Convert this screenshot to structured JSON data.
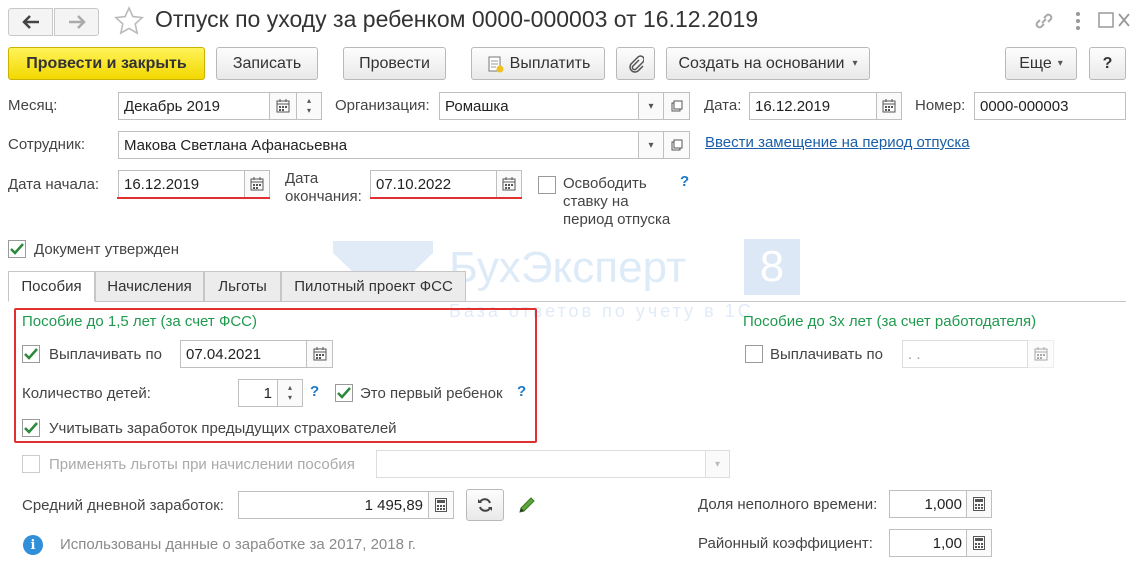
{
  "window": {
    "title": "Отпуск по уходу за ребенком 0000-000003 от 16.12.2019",
    "back_icon": "arrow-left-icon",
    "forward_icon": "arrow-right-icon",
    "star_icon": "star-icon",
    "menu_icons": [
      "link-icon",
      "more-vertical-icon",
      "maximize-icon",
      "close-icon"
    ]
  },
  "toolbar": {
    "post_close": "Провести и закрыть",
    "save": "Записать",
    "post": "Провести",
    "pay": "Выплатить",
    "create_based": "Создать на основании",
    "more": "Еще",
    "help": "?"
  },
  "header": {
    "month_label": "Месяц:",
    "month_value": "Декабрь 2019",
    "org_label": "Организация:",
    "org_value": "Ромашка",
    "date_label": "Дата:",
    "date_value": "16.12.2019",
    "number_label": "Номер:",
    "number_value": "0000-000003",
    "employee_label": "Сотрудник:",
    "employee_value": "Макова Светлана Афанасьевна",
    "replacement_link": "Ввести замещение на период отпуска",
    "start_label": "Дата начала:",
    "start_value": "16.12.2019",
    "end_label_1": "Дата",
    "end_label_2": "окончания:",
    "end_value": "07.10.2022",
    "free_rate_1": "Освободить",
    "free_rate_2": "ставку на",
    "free_rate_3": "период отпуска",
    "help_q": "?",
    "approved": "Документ утвержден"
  },
  "watermark": {
    "text": "БухЭксперт",
    "digit": "8",
    "subtext": "База ответов по учету в 1С"
  },
  "tabs": [
    "Пособия",
    "Начисления",
    "Льготы",
    "Пилотный проект ФСС"
  ],
  "benefits": {
    "fss_title": "Пособие до 1,5 лет (за счет ФСС)",
    "pay_until_label": "Выплачивать по",
    "pay_until_value": "07.04.2021",
    "children_label": "Количество детей:",
    "children_value": "1",
    "first_child": "Это первый ребенок",
    "prev_insurers": "Учитывать заработок предыдущих страхователей",
    "employer_title": "Пособие до 3х лет (за счет работодателя)",
    "employer_pay_label": "Выплачивать по",
    "employer_pay_value": " .  .",
    "apply_benefits": "Применять льготы при начислении пособия",
    "avg_label": "Средний дневной заработок:",
    "avg_value": "1 495,89",
    "part_time_label": "Доля неполного времени:",
    "part_time_value": "1,000",
    "regional_label": "Районный коэффициент:",
    "regional_value": "1,00",
    "info_text": "Использованы данные о заработке за  2017,  2018 г."
  },
  "colors": {
    "primary_button": "#f5dc00",
    "green_caption": "#1f9a4e",
    "highlight_red": "#e03030",
    "link_blue": "#1a5fa8"
  }
}
